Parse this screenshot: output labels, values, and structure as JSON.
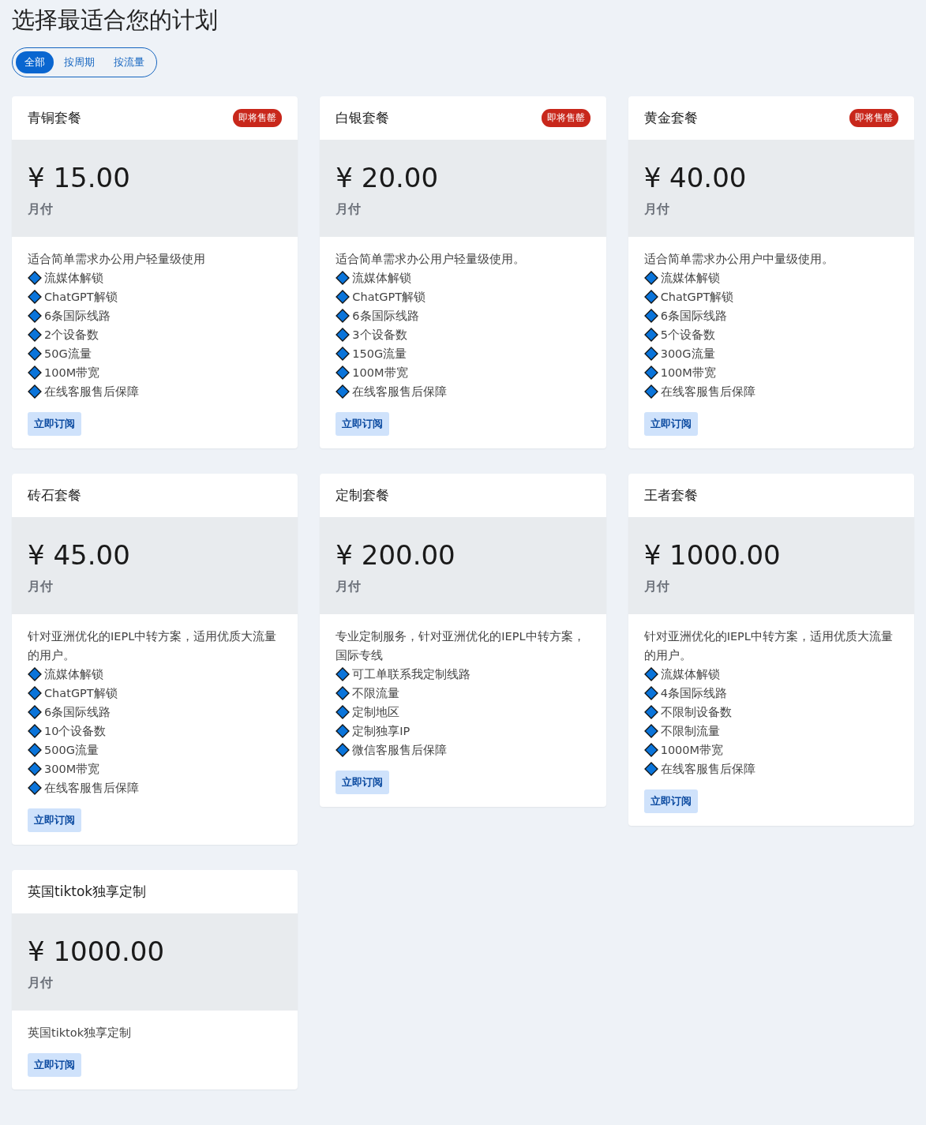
{
  "title": "选择最适合您的计划",
  "filters": [
    {
      "label": "全部",
      "selected": true
    },
    {
      "label": "按周期",
      "selected": false
    },
    {
      "label": "按流量",
      "selected": false
    }
  ],
  "plans": [
    {
      "name": "青铜套餐",
      "badge": "即将售罄",
      "price": "¥ 15.00",
      "period": "月付",
      "description": "适合简单需求办公用户轻量级使用",
      "features": [
        "流媒体解锁",
        "ChatGPT解锁",
        "6条国际线路",
        "2个设备数",
        "50G流量",
        "100M带宽",
        "在线客服售后保障"
      ],
      "button": "立即订阅"
    },
    {
      "name": "白银套餐",
      "badge": "即将售罄",
      "price": "¥ 20.00",
      "period": "月付",
      "description": "适合简单需求办公用户轻量级使用。",
      "features": [
        "流媒体解锁",
        "ChatGPT解锁",
        "6条国际线路",
        "3个设备数",
        "150G流量",
        "100M带宽",
        "在线客服售后保障"
      ],
      "button": "立即订阅"
    },
    {
      "name": "黄金套餐",
      "badge": "即将售罄",
      "price": "¥ 40.00",
      "period": "月付",
      "description": "适合简单需求办公用户中量级使用。",
      "features": [
        "流媒体解锁",
        "ChatGPT解锁",
        "6条国际线路",
        "5个设备数",
        "300G流量",
        "100M带宽",
        "在线客服售后保障"
      ],
      "button": "立即订阅"
    },
    {
      "name": "砖石套餐",
      "price": "¥ 45.00",
      "period": "月付",
      "description": "针对亚洲优化的IEPL中转方案，适用优质大流量的用户。",
      "features": [
        "流媒体解锁",
        "ChatGPT解锁",
        "6条国际线路",
        "10个设备数",
        "500G流量",
        "300M带宽",
        "在线客服售后保障"
      ],
      "button": "立即订阅"
    },
    {
      "name": "定制套餐",
      "price": "¥ 200.00",
      "period": "月付",
      "description": "专业定制服务，针对亚洲优化的IEPL中转方案，国际专线",
      "features": [
        "可工单联系我定制线路",
        "不限流量",
        "定制地区",
        "定制独享IP",
        "微信客服售后保障"
      ],
      "button": "立即订阅"
    },
    {
      "name": "王者套餐",
      "price": "¥ 1000.00",
      "period": "月付",
      "description": "针对亚洲优化的IEPL中转方案，适用优质大流量的用户。",
      "features": [
        "流媒体解锁",
        "4条国际线路",
        "不限制设备数",
        "不限制流量",
        "1000M带宽",
        "在线客服售后保障"
      ],
      "button": "立即订阅"
    },
    {
      "name": "英国tiktok独享定制",
      "price": "¥ 1000.00",
      "period": "月付",
      "description": "英国tiktok独享定制",
      "button": "立即订阅"
    }
  ]
}
